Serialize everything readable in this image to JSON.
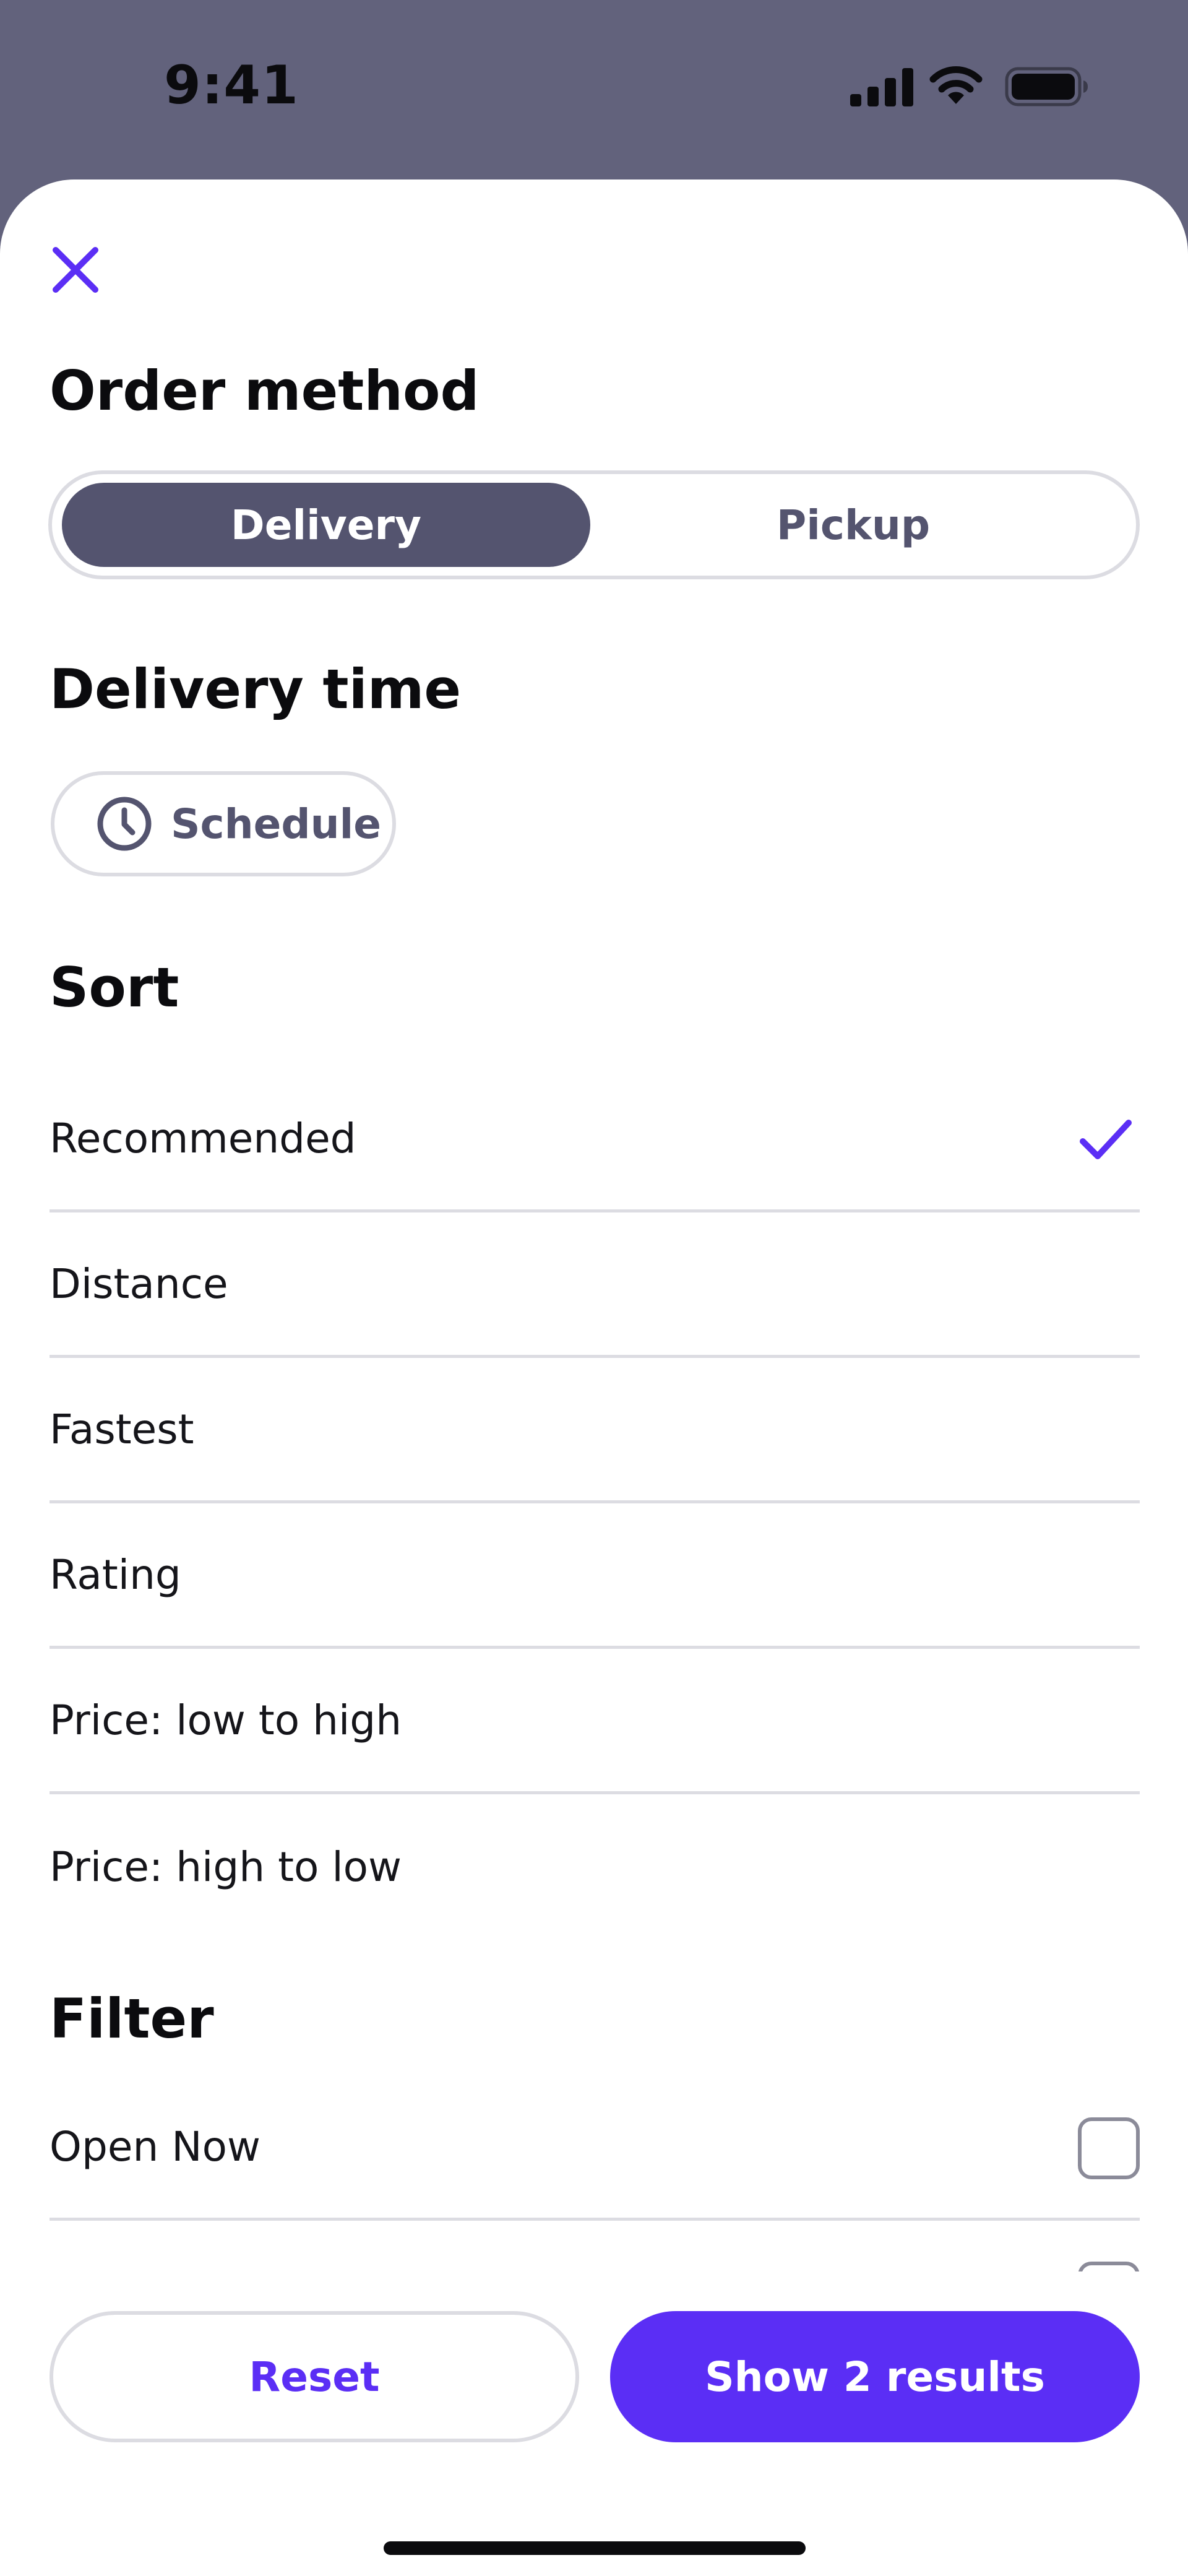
{
  "status_bar": {
    "time": "9:41",
    "icons": [
      "signal-icon",
      "wifi-icon",
      "battery-icon"
    ]
  },
  "sheet": {
    "close_icon": "close-icon"
  },
  "order_method": {
    "title": "Order method",
    "options": [
      {
        "label": "Delivery",
        "selected": true
      },
      {
        "label": "Pickup",
        "selected": false
      }
    ]
  },
  "delivery_time": {
    "title": "Delivery time",
    "schedule_label": "Schedule",
    "schedule_icon": "clock-icon"
  },
  "sort": {
    "title": "Sort",
    "selected_index": 0,
    "options": [
      {
        "label": "Recommended"
      },
      {
        "label": "Distance"
      },
      {
        "label": "Fastest"
      },
      {
        "label": "Rating"
      },
      {
        "label": "Price: low to high"
      },
      {
        "label": "Price: high to low"
      }
    ]
  },
  "filter": {
    "title": "Filter",
    "options": [
      {
        "label": "Open Now",
        "checked": false
      }
    ]
  },
  "footer": {
    "reset_label": "Reset",
    "show_results_label": "Show 2 results"
  },
  "colors": {
    "accent": "#5B2EF5",
    "segment_active": "#54546F",
    "backdrop": "#62627C",
    "divider": "#DCDCE2"
  }
}
